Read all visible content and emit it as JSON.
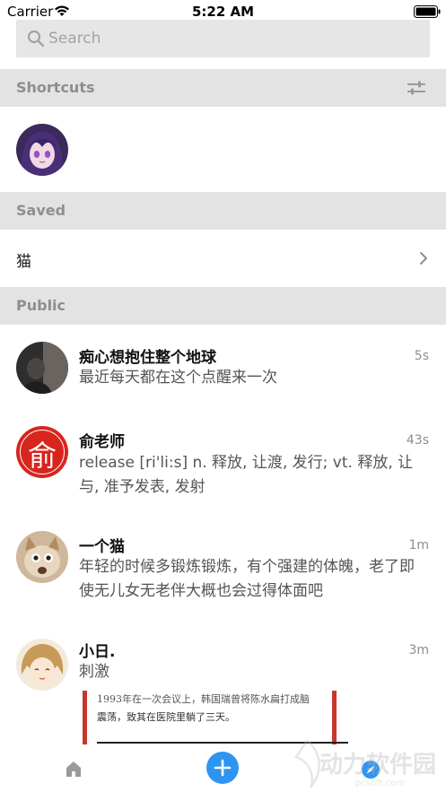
{
  "status_bar": {
    "carrier": "Carrier",
    "time": "5:22 AM"
  },
  "search": {
    "placeholder": "Search"
  },
  "sections": {
    "shortcuts": "Shortcuts",
    "saved": "Saved",
    "public": "Public"
  },
  "saved_items": [
    {
      "label": "猫"
    }
  ],
  "chats": [
    {
      "name": "痴心想抱住整个地球",
      "time": "5s",
      "message": "最近每天都在这个点醒来一次"
    },
    {
      "name": "俞老师",
      "time": "43s",
      "message": "release [ri'li:s] n. 释放, 让渡, 发行; vt. 释放, 让与, 准予发表, 发射",
      "avatar_text": "俞"
    },
    {
      "name": "一个猫",
      "time": "1m",
      "message": "年轻的时候多锻炼锻炼，有个强建的体魄，老了即使无儿女无老伴大概也会过得体面吧"
    },
    {
      "name": "小日.",
      "time": "3m",
      "message": "刺激"
    }
  ],
  "peek_card": {
    "line1": "1993年在一次会议上，韩国瑞曾将陈水扁打成脑",
    "line2": "震荡，致其在医院里躺了三天。"
  },
  "watermark": {
    "brand": "动力软件园",
    "url": "pcsoft.com"
  },
  "colors": {
    "accent": "#2d95f0",
    "section_bg": "#e3e3e3",
    "search_bg": "#e6e6e6",
    "avatar_red": "#d8251d"
  }
}
